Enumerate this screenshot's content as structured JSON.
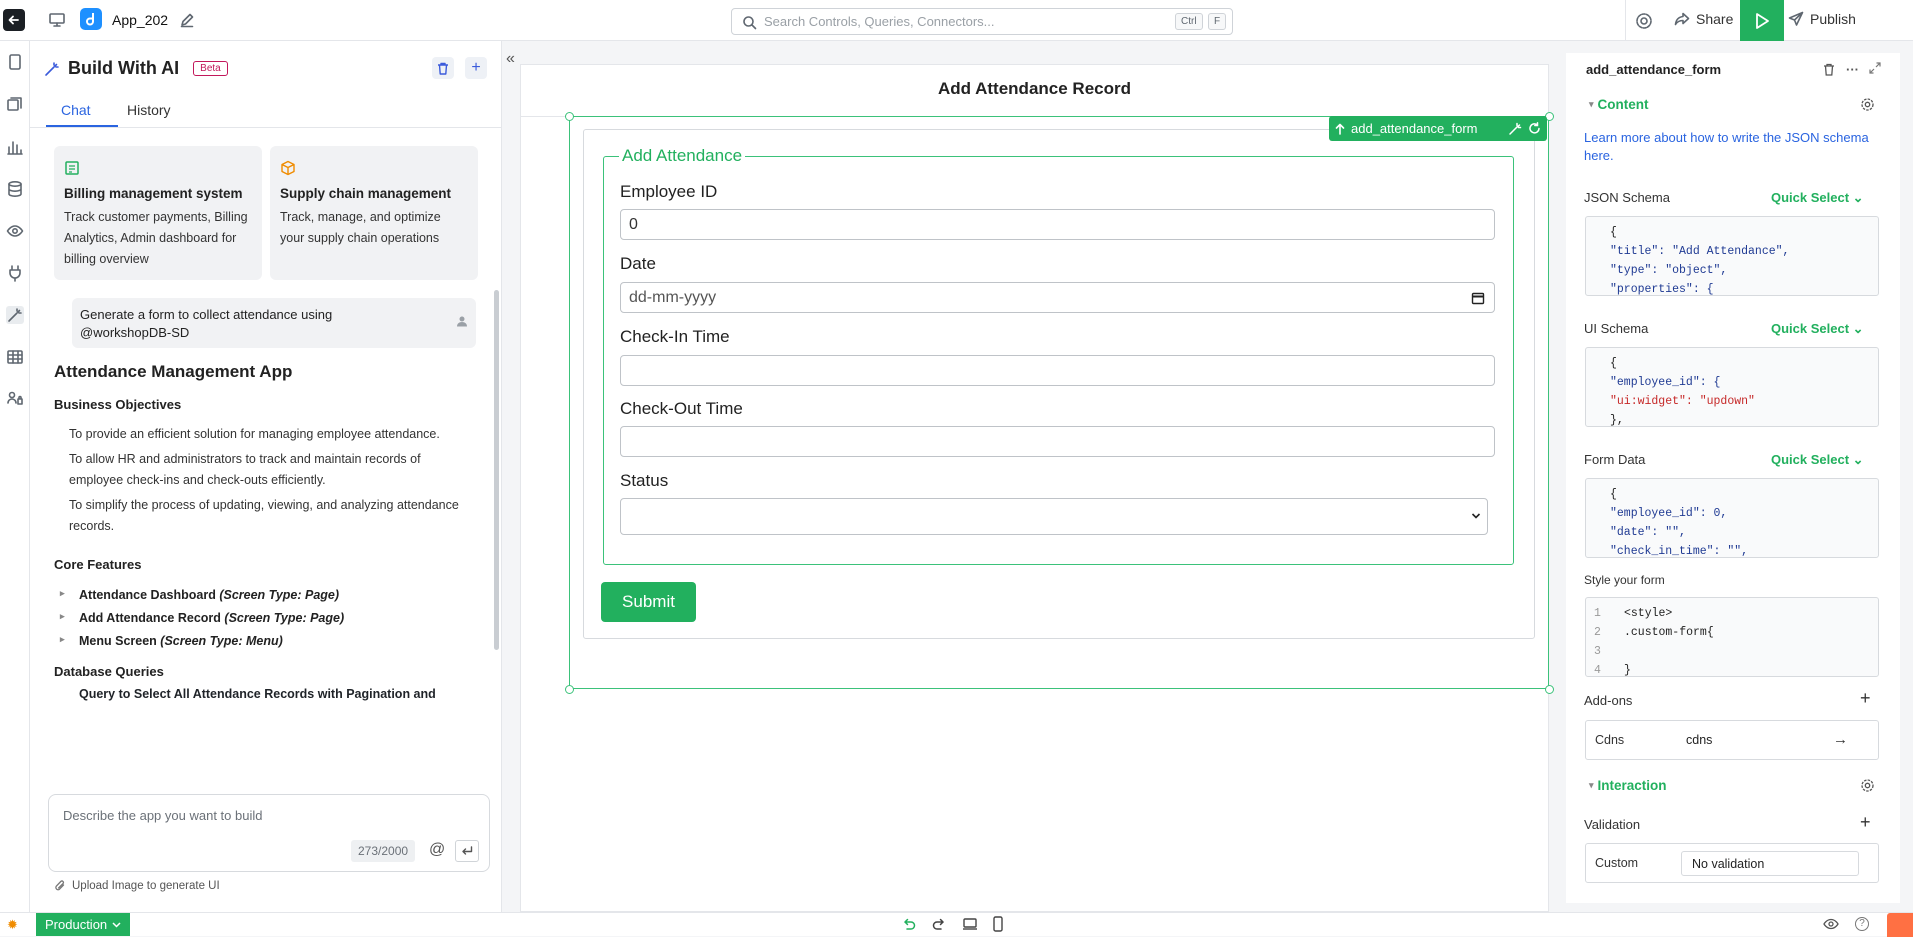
{
  "topbar": {
    "app_name": "App_202",
    "search_placeholder": "Search Controls, Queries, Connectors...",
    "kbd_ctrl": "Ctrl",
    "kbd_f": "F",
    "share": "Share",
    "publish": "Publish"
  },
  "ai_panel": {
    "title": "Build With AI",
    "badge": "Beta",
    "tabs": [
      "Chat",
      "History"
    ],
    "templates": [
      {
        "title": "Billing management system",
        "desc": "Track customer payments, Billing Analytics, Admin dashboard for billing overview"
      },
      {
        "title": "Supply chain management",
        "desc": "Track, manage, and optimize your supply chain operations"
      }
    ],
    "user_message": "Generate a form to collect attendance using @workshopDB-SD",
    "response": {
      "heading": "Attendance Management App",
      "objectives_title": "Business Objectives",
      "objectives": [
        "To provide an efficient solution for managing employee attendance.",
        "To allow HR and administrators to track and maintain records of employee check-ins and check-outs efficiently.",
        "To simplify the process of updating, viewing, and analyzing attendance records."
      ],
      "features_title": "Core Features",
      "features": [
        {
          "name": "Attendance Dashboard",
          "type": "(Screen Type: Page)"
        },
        {
          "name": "Add Attendance Record",
          "type": "(Screen Type: Page)"
        },
        {
          "name": "Menu Screen",
          "type": "(Screen Type: Menu)"
        }
      ],
      "queries_title": "Database Queries",
      "query_item": "Query to Select All Attendance Records with Pagination and"
    },
    "prompt_placeholder": "Describe the app you want to build",
    "char_count": "273/2000",
    "at_symbol": "@",
    "upload_label": "Upload Image to generate UI"
  },
  "canvas": {
    "page_title": "Add Attendance Record",
    "selected_control": "add_attendance_form",
    "form": {
      "legend": "Add Attendance",
      "fields": [
        {
          "label": "Employee ID",
          "value": "0"
        },
        {
          "label": "Date",
          "value": "dd-mm-yyyy"
        },
        {
          "label": "Check-In Time",
          "value": ""
        },
        {
          "label": "Check-Out Time",
          "value": ""
        },
        {
          "label": "Status",
          "value": ""
        }
      ],
      "submit": "Submit"
    }
  },
  "props": {
    "title": "add_attendance_form",
    "content_section": "Content",
    "learn_more": "Learn more about how to write the JSON schema here.",
    "json_schema_label": "JSON Schema",
    "ui_schema_label": "UI Schema",
    "form_data_label": "Form Data",
    "quick_select": "Quick Select",
    "json_schema_lines": [
      "{",
      "  \"title\": \"Add Attendance\",",
      "  \"type\": \"object\",",
      "  \"properties\": {"
    ],
    "ui_schema_lines": [
      "{",
      "  \"employee_id\": {",
      "    \"ui:widget\": \"updown\"",
      "  },"
    ],
    "form_data_lines": [
      "{",
      "  \"employee_id\": 0,",
      "  \"date\": \"\",",
      "  \"check_in_time\": \"\","
    ],
    "style_label": "Style your form",
    "style_lines": [
      "<style>",
      "  .custom-form{",
      "",
      "  }"
    ],
    "addons_label": "Add-ons",
    "cdns_key": "Cdns",
    "cdns_value": "cdns",
    "interaction_section": "Interaction",
    "validation_label": "Validation",
    "custom_key": "Custom",
    "custom_value": "No validation"
  },
  "footer": {
    "env": "Production"
  },
  "colors": {
    "accent": "#22b05e",
    "link": "#2a64e0"
  }
}
